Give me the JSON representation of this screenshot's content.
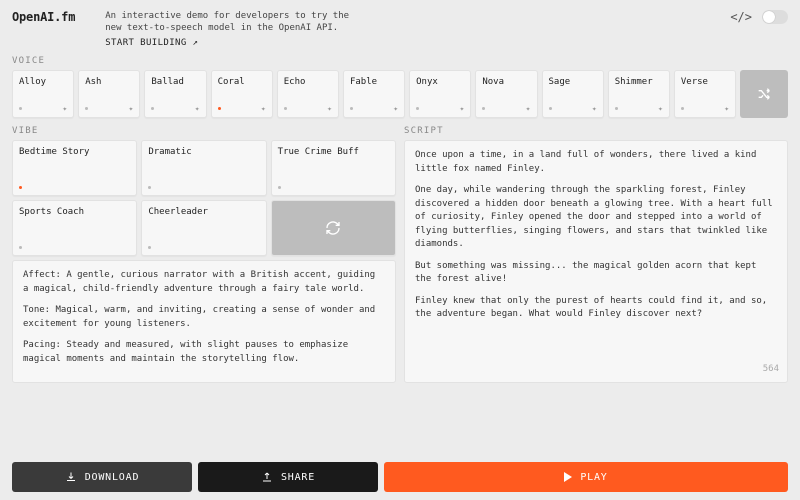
{
  "header": {
    "logo": "OpenAI.fm",
    "tagline": "An interactive demo for developers to try the new text-to-speech model in the OpenAI API.",
    "start_building": "START BUILDING ↗"
  },
  "labels": {
    "voice": "VOICE",
    "vibe": "VIBE",
    "script": "SCRIPT"
  },
  "voices": [
    {
      "name": "Alloy",
      "selected": false
    },
    {
      "name": "Ash",
      "selected": false
    },
    {
      "name": "Ballad",
      "selected": false
    },
    {
      "name": "Coral",
      "selected": true
    },
    {
      "name": "Echo",
      "selected": false
    },
    {
      "name": "Fable",
      "selected": false
    },
    {
      "name": "Onyx",
      "selected": false
    },
    {
      "name": "Nova",
      "selected": false
    },
    {
      "name": "Sage",
      "selected": false
    },
    {
      "name": "Shimmer",
      "selected": false
    },
    {
      "name": "Verse",
      "selected": false
    }
  ],
  "vibes": [
    {
      "name": "Bedtime Story",
      "selected": true
    },
    {
      "name": "Dramatic",
      "selected": false
    },
    {
      "name": "True Crime Buff",
      "selected": false
    },
    {
      "name": "Sports Coach",
      "selected": false
    },
    {
      "name": "Cheerleader",
      "selected": false
    }
  ],
  "prompt": {
    "p1": "Affect: A gentle, curious narrator with a British accent, guiding a magical, child-friendly adventure through a fairy tale world.",
    "p2": "Tone: Magical, warm, and inviting, creating a sense of wonder and excitement for young listeners.",
    "p3": "Pacing: Steady and measured, with slight pauses to emphasize magical moments and maintain the storytelling flow."
  },
  "script": {
    "p1": "Once upon a time, in a land full of wonders, there lived a kind little fox named Finley.",
    "p2": "One day, while wandering through the sparkling forest, Finley discovered a hidden door beneath a glowing tree. With a heart full of curiosity, Finley opened the door and stepped into a world of flying butterflies, singing flowers, and stars that twinkled like diamonds.",
    "p3": "But something was missing... the magical golden acorn that kept the forest alive!",
    "p4": "Finley knew that only the purest of hearts could find it, and so, the adventure began. What would Finley discover next?",
    "char_count": "564"
  },
  "actions": {
    "download": "DOWNLOAD",
    "share": "SHARE",
    "play": "PLAY"
  },
  "colors": {
    "accent": "#ff5a1f"
  }
}
